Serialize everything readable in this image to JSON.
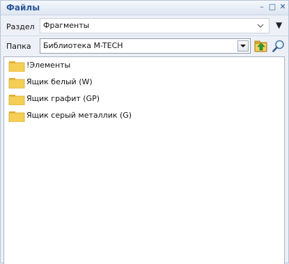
{
  "title": "Файлы",
  "window_buttons": {
    "minimize": "–",
    "restore": "□",
    "close": "✕"
  },
  "section": {
    "label": "Раздел",
    "value": "Фрагменты",
    "menu_glyph": "▼"
  },
  "folder": {
    "label": "Папка",
    "value": "Библиотека M-TECH"
  },
  "icons": {
    "up": "folder-up-icon",
    "search": "magnifier-icon",
    "item": "folder-icon"
  },
  "files": [
    {
      "name": "!Элементы"
    },
    {
      "name": "Ящик белый (W)"
    },
    {
      "name": "Ящик графит (GP)"
    },
    {
      "name": "Ящик серый металлик (G)"
    }
  ],
  "colors": {
    "title": "#2c5899",
    "folder": "#f5cf55"
  }
}
